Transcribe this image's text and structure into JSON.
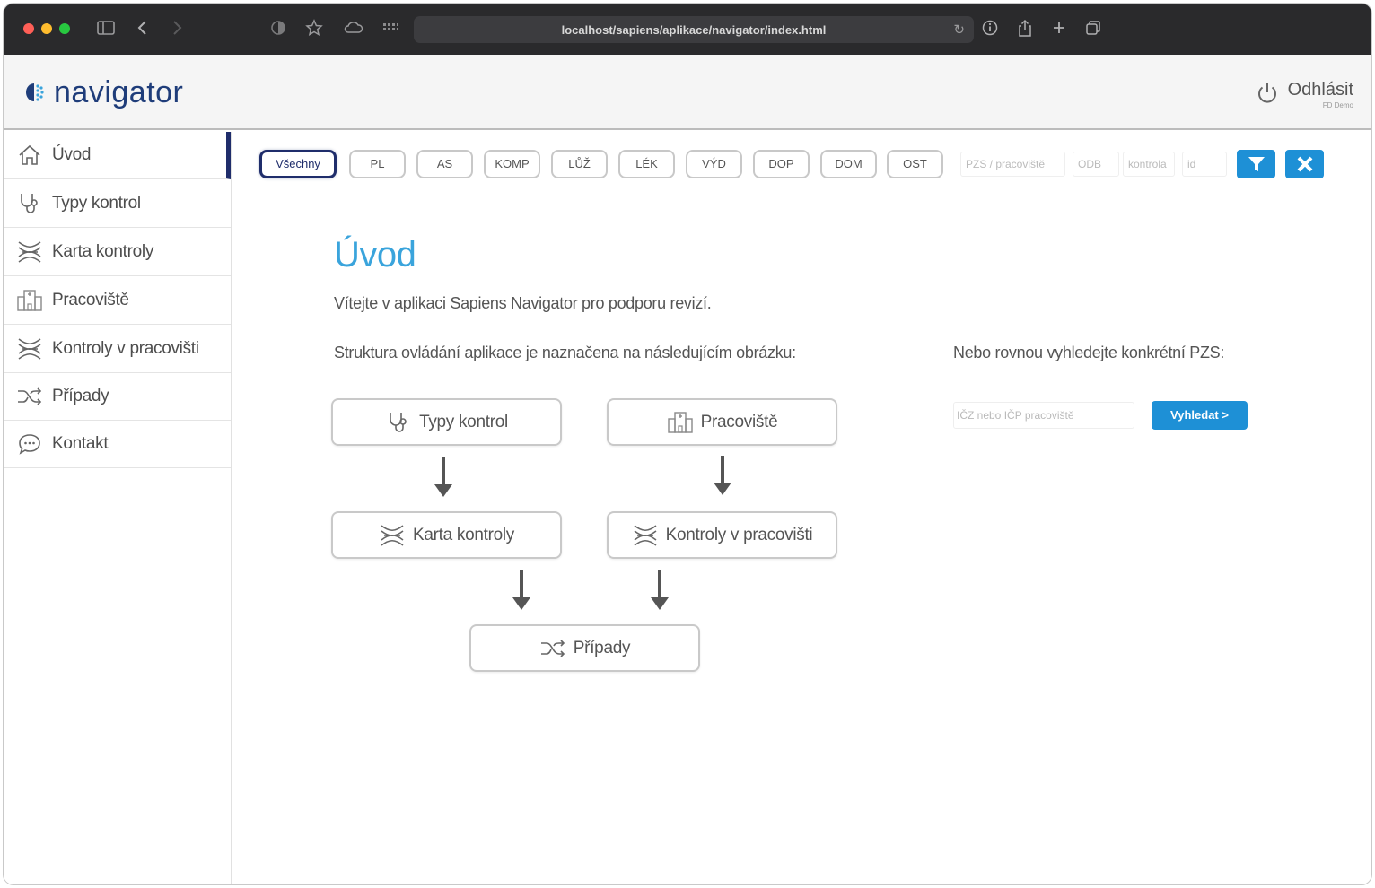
{
  "browser": {
    "url": "localhost/sapiens/aplikace/navigator/index.html",
    "traffic_colors": [
      "#ff5f57",
      "#febc2e",
      "#28c840"
    ]
  },
  "header": {
    "logo_text": "navigator",
    "logout_label": "Odhlásit",
    "logout_sub": "FD Demo"
  },
  "sidebar": {
    "items": [
      {
        "label": "Úvod",
        "icon": "home-icon",
        "active": true
      },
      {
        "label": "Typy kontrol",
        "icon": "stethoscope-icon"
      },
      {
        "label": "Karta kontroly",
        "icon": "dna-icon"
      },
      {
        "label": "Pracoviště",
        "icon": "building-icon"
      },
      {
        "label": "Kontroly v pracovišti",
        "icon": "dna-icon"
      },
      {
        "label": "Případy",
        "icon": "shuffle-icon"
      },
      {
        "label": "Kontakt",
        "icon": "chat-icon"
      }
    ]
  },
  "filter": {
    "chips": [
      "Všechny",
      "PL",
      "AS",
      "KOMP",
      "LŮŽ",
      "LÉK",
      "VÝD",
      "DOP",
      "DOM",
      "OST"
    ],
    "active_chip": "Všechny",
    "inputs": {
      "pzs": "PZS / pracoviště",
      "odb": "ODB",
      "kontrola": "kontrola",
      "id": "id"
    }
  },
  "main": {
    "title": "Úvod",
    "welcome": "Vítejte v aplikaci Sapiens Navigator pro podporu revizí.",
    "structure": "Struktura ovládání aplikace je naznačena na následujícím obrázku:",
    "search_label": "Nebo rovnou vyhledejte konkrétní PZS:",
    "search_placeholder": "IČZ nebo IČP pracoviště",
    "search_button": "Vyhledat >"
  },
  "diagram": {
    "typy": "Typy kontrol",
    "pracoviste": "Pracoviště",
    "karta": "Karta kontroly",
    "kontroly": "Kontroly v pracovišti",
    "pripady": "Případy"
  },
  "colors": {
    "accent": "#3aa4dc",
    "button": "#1e90d6",
    "navy": "#1f2d6b"
  }
}
